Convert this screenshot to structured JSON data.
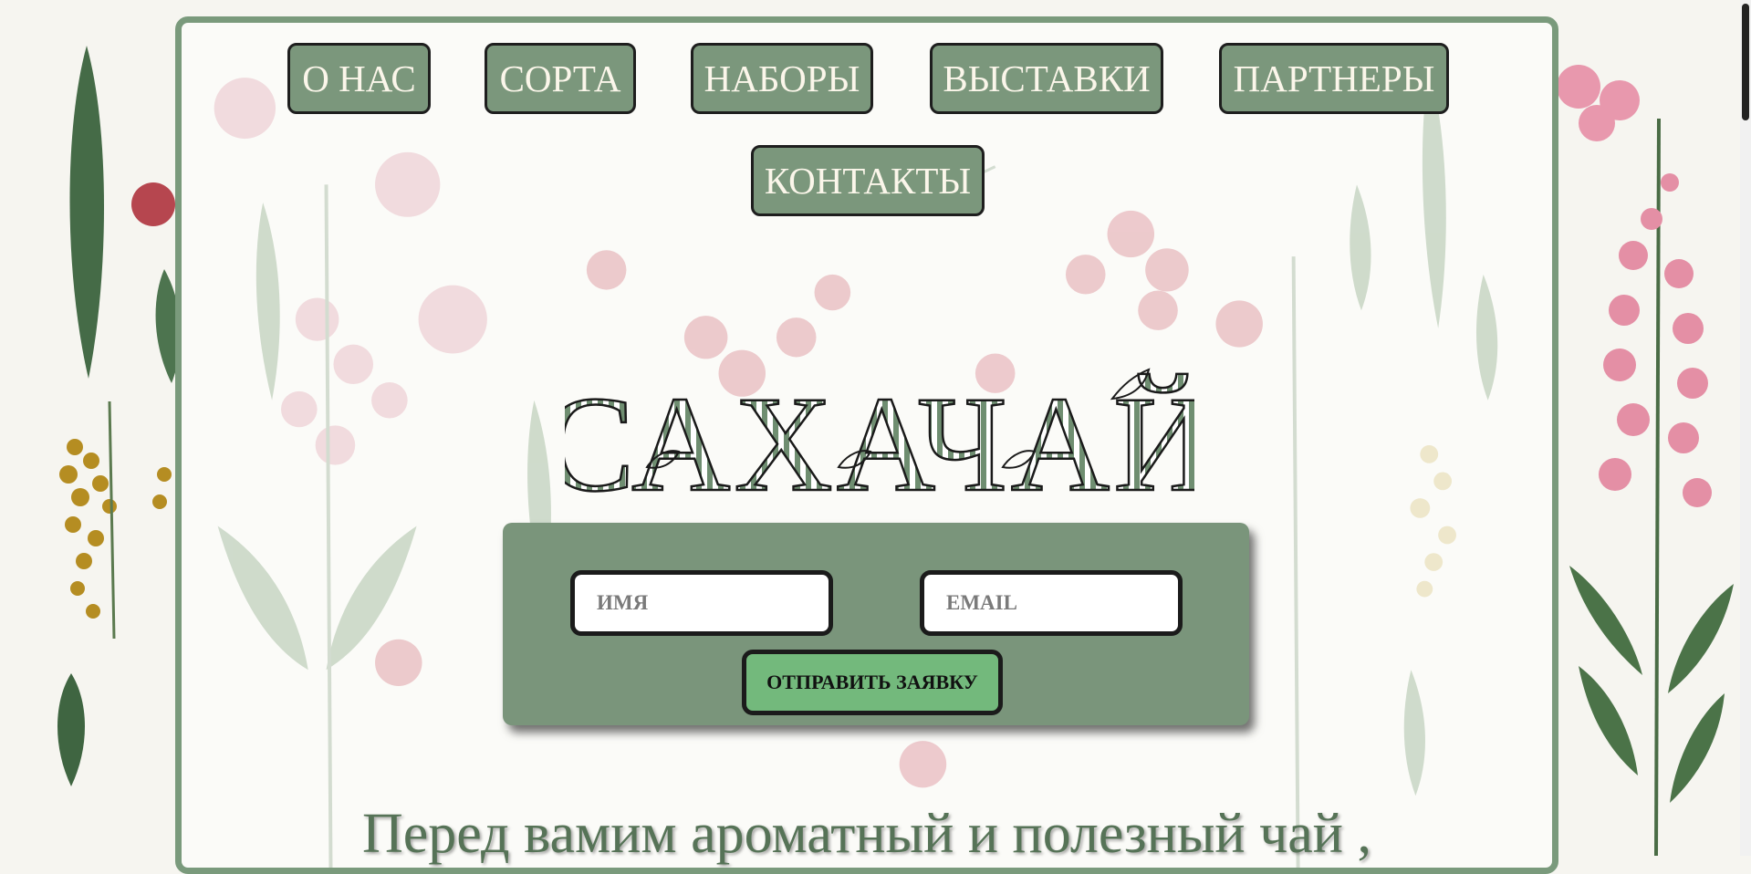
{
  "nav": {
    "items": [
      {
        "label": "О НАС"
      },
      {
        "label": "СОРТА"
      },
      {
        "label": "НАБОРЫ"
      },
      {
        "label": "ВЫСТАВКИ"
      },
      {
        "label": "ПАРТНЕРЫ"
      },
      {
        "label": "КОНТАКТЫ"
      }
    ]
  },
  "logo": {
    "text": "САХАЧАЙ"
  },
  "form": {
    "name_placeholder": "ИМЯ",
    "email_placeholder": "EMAIL",
    "submit_label": "ОТПРАВИТЬ ЗАЯВКУ"
  },
  "hero": {
    "tagline": "Перед вамим ароматный и полезный чай ,"
  },
  "colors": {
    "frame": "#7a9a7c",
    "nav_button": "#7b977c",
    "submit_button": "#73b97c",
    "tagline": "#567357"
  }
}
